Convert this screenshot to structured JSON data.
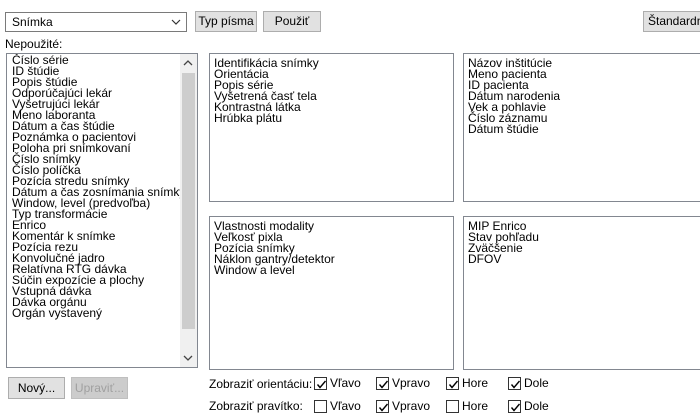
{
  "dropdown": {
    "value": "Snímka",
    "icon": "chevron-down-icon"
  },
  "toolbar": {
    "font_label": "Typ písma",
    "apply_label": "Použiť",
    "default_label": "Štandardné"
  },
  "unused": {
    "label": "Nepoužité:",
    "items": [
      "Číslo série",
      "ID štúdie",
      "Popis štúdie",
      "Odporúčajúci lekár",
      "Vyšetrujúci lekár",
      "Meno laboranta",
      "Dátum a čas štúdie",
      "Poznámka o pacientovi",
      "Poloha pri snímkovaní",
      "Číslo snímky",
      "Číslo políčka",
      "Pozícia stredu snímky",
      "Dátum a čas zosnímania snímky",
      "Window, level (predvoľba)",
      "Typ transformácie",
      "Enrico",
      "Komentár k snímke",
      "Pozícia rezu",
      "Konvolučné jadro",
      "Relatívna RTG dávka",
      "Súčin expozície a plochy",
      "Vstupná dávka",
      "Dávka orgánu",
      "Orgán vystavený"
    ]
  },
  "boxes": {
    "top_left": [
      "Identifikácia snímky",
      "Orientácia",
      "Popis série",
      "Vyšetrená časť tela",
      "Kontrastná látka",
      "Hrúbka plátu"
    ],
    "top_right": [
      "Názov inštitúcie",
      "Meno pacienta",
      "ID pacienta",
      "Dátum narodenia",
      "Vek a pohlavie",
      "Číslo záznamu",
      "Dátum štúdie"
    ],
    "bottom_left": [
      "Vlastnosti modality",
      "Veľkosť pixla",
      "Pozícia snímky",
      "Náklon gantry/detektor",
      "Window a level"
    ],
    "bottom_right": [
      "MIP Enrico",
      "Stav pohľadu",
      "Zväčšenie",
      "DFOV"
    ]
  },
  "buttons": {
    "new_label": "Nový...",
    "edit_label": "Upraviť..."
  },
  "orientation": {
    "label": "Zobraziť orientáciu:",
    "options": [
      {
        "label": "Vľavo",
        "checked": true
      },
      {
        "label": "Vpravo",
        "checked": true
      },
      {
        "label": "Hore",
        "checked": true
      },
      {
        "label": "Dole",
        "checked": true
      }
    ]
  },
  "ruler": {
    "label": "Zobraziť pravítko:",
    "options": [
      {
        "label": "Vľavo",
        "checked": false
      },
      {
        "label": "Vpravo",
        "checked": true
      },
      {
        "label": "Hore",
        "checked": false
      },
      {
        "label": "Dole",
        "checked": true
      }
    ]
  }
}
